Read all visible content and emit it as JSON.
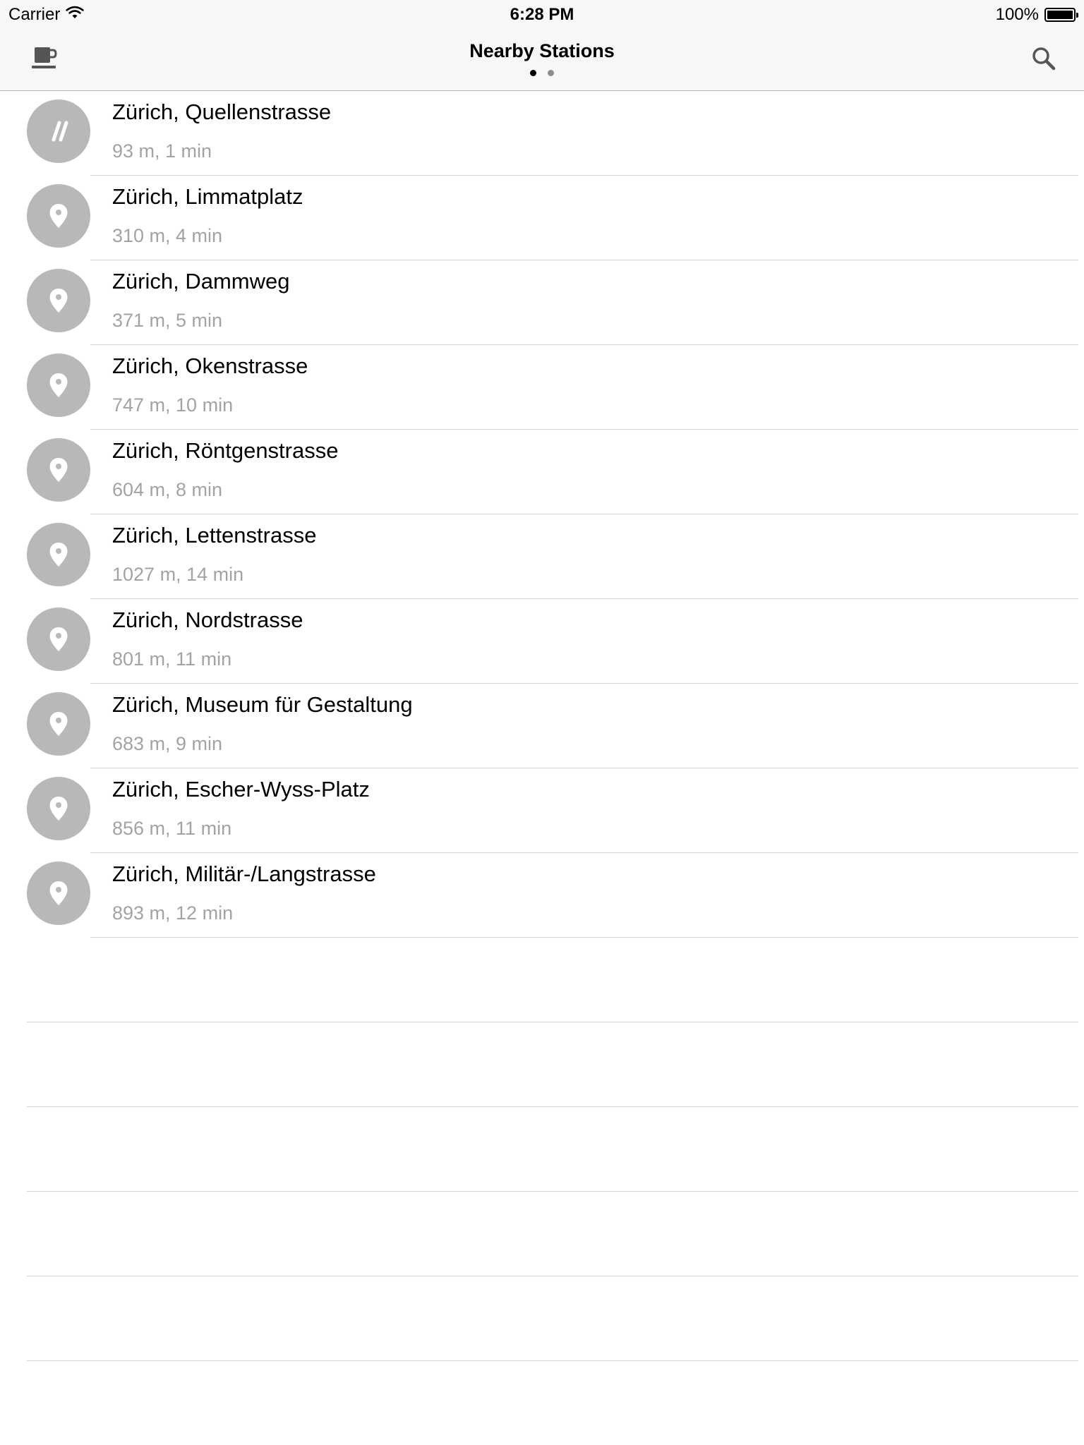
{
  "status_bar": {
    "carrier": "Carrier",
    "time": "6:28 PM",
    "battery": "100%",
    "battery_level": 1.0,
    "icons": [
      "wifi-icon",
      "battery-icon"
    ]
  },
  "nav": {
    "title": "Nearby Stations",
    "page_count": 2,
    "current_page": 1,
    "left_icon": "coffee-cup-icon",
    "right_icon": "search-icon"
  },
  "stations": [
    {
      "name": "Zürich, Quellenstrasse",
      "detail": "93 m, 1 min",
      "icon": "tram-icon"
    },
    {
      "name": "Zürich, Limmatplatz",
      "detail": "310 m, 4 min",
      "icon": "location-pin-icon"
    },
    {
      "name": "Zürich, Dammweg",
      "detail": "371 m, 5 min",
      "icon": "location-pin-icon"
    },
    {
      "name": "Zürich, Okenstrasse",
      "detail": "747 m, 10 min",
      "icon": "location-pin-icon"
    },
    {
      "name": "Zürich, Röntgenstrasse",
      "detail": "604 m, 8 min",
      "icon": "location-pin-icon"
    },
    {
      "name": "Zürich, Lettenstrasse",
      "detail": "1027 m, 14 min",
      "icon": "location-pin-icon"
    },
    {
      "name": "Zürich, Nordstrasse",
      "detail": "801 m, 11 min",
      "icon": "location-pin-icon"
    },
    {
      "name": "Zürich, Museum für Gestaltung",
      "detail": "683 m, 9 min",
      "icon": "location-pin-icon"
    },
    {
      "name": "Zürich, Escher-Wyss-Platz",
      "detail": "856 m, 11 min",
      "icon": "location-pin-icon"
    },
    {
      "name": "Zürich, Militär-/Langstrasse",
      "detail": "893 m, 12 min",
      "icon": "location-pin-icon"
    }
  ],
  "colors": {
    "bar_background": "#f7f7f7",
    "icon_circle": "#b8b8b8",
    "detail_text": "#a3a3a3",
    "separator": "#d4d4d4"
  }
}
